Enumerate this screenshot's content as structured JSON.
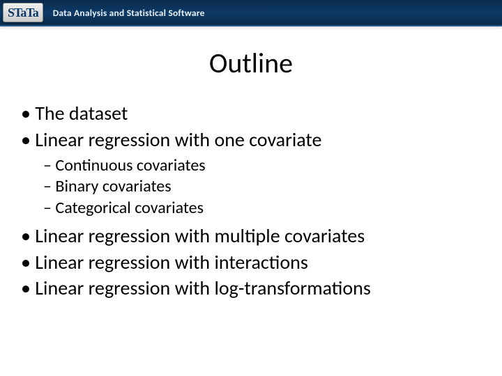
{
  "header": {
    "logo_text": "STaTa",
    "tagline": "Data Analysis and Statistical Software"
  },
  "title": "Outline",
  "bullets": {
    "b1": "The dataset",
    "b2": "Linear regression with one covariate",
    "b2_sub": {
      "s1": "Continuous covariates",
      "s2": "Binary covariates",
      "s3": "Categorical covariates"
    },
    "b3": "Linear regression with multiple covariates",
    "b4": "Linear regression with interactions",
    "b5": "Linear regression with log-transformations"
  }
}
